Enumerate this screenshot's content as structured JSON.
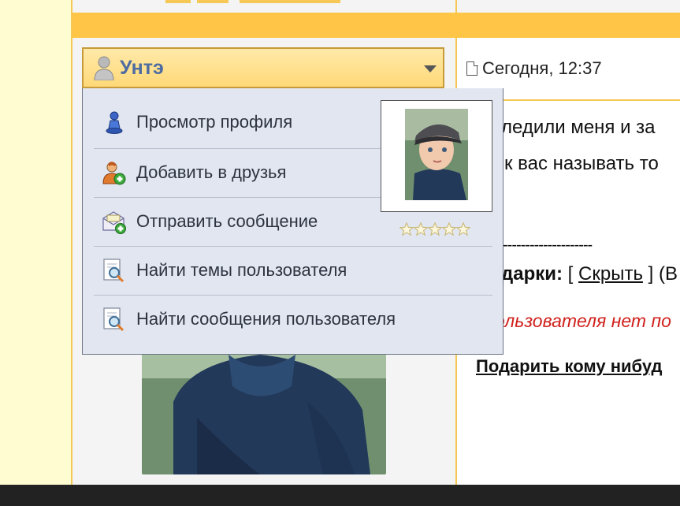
{
  "user_menu": {
    "username": "Унтэ",
    "items": [
      {
        "label": "Просмотр профиля",
        "icon": "profile-pawn-icon"
      },
      {
        "label": "Добавить в друзья",
        "icon": "add-friend-icon"
      },
      {
        "label": "Отправить сообщение",
        "icon": "send-message-icon"
      },
      {
        "label": "Найти темы пользователя",
        "icon": "find-topics-icon"
      },
      {
        "label": "Найти сообщения пользователя",
        "icon": "find-posts-icon"
      }
    ],
    "rating_stars": 5,
    "rating_filled": 0
  },
  "post": {
    "date": "Сегодня, 12:37",
    "line1": "ледили меня и за",
    "line2": "к вас называть то",
    "dashes": "--------------------",
    "gifts_label": "дарки:",
    "gifts_open": " [ ",
    "gifts_hide": "Скрыть",
    "gifts_close": " ] (В",
    "no_gifts": "ользователя нет по",
    "gift_link": "Подарить кому нибуд"
  },
  "colors": {
    "accent_band": "#ffc546",
    "border": "#f6c855",
    "menu_bg": "#e1e6f0",
    "username": "#4d6ca1",
    "red_note": "#d0201c"
  }
}
